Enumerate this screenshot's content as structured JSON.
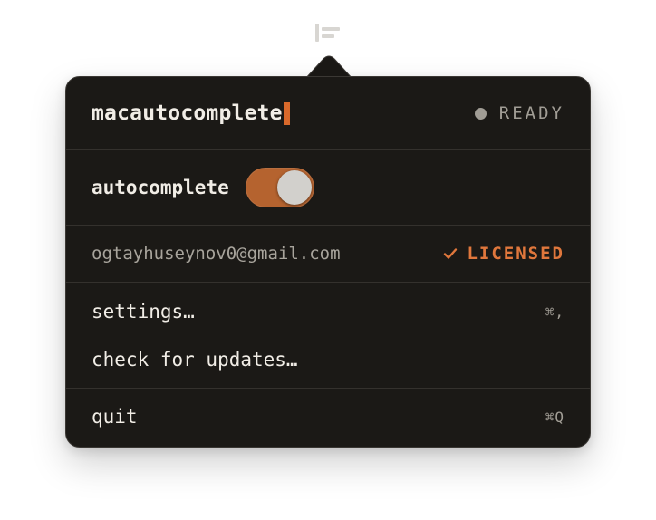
{
  "menubar": {
    "icon": "macautocomplete-menubar-icon"
  },
  "header": {
    "app_name": "macautocomplete",
    "status_label": "READY",
    "status_color": "#a19d95",
    "cursor_color": "#d9692b"
  },
  "autocomplete": {
    "label": "autocomplete",
    "enabled": true,
    "toggle_color": "#b5632f"
  },
  "license": {
    "email": "ogtayhuseynov0@gmail.com",
    "status_label": "LICENSED",
    "status_icon": "check-icon",
    "status_color": "#e0773c"
  },
  "menu": {
    "settings": {
      "label": "settings…",
      "shortcut": "⌘,"
    },
    "updates": {
      "label": "check for updates…",
      "shortcut": ""
    },
    "quit": {
      "label": "quit",
      "shortcut": "⌘Q"
    }
  },
  "colors": {
    "background": "#1b1916",
    "accent": "#d9692b",
    "text": "#f1ede6"
  }
}
